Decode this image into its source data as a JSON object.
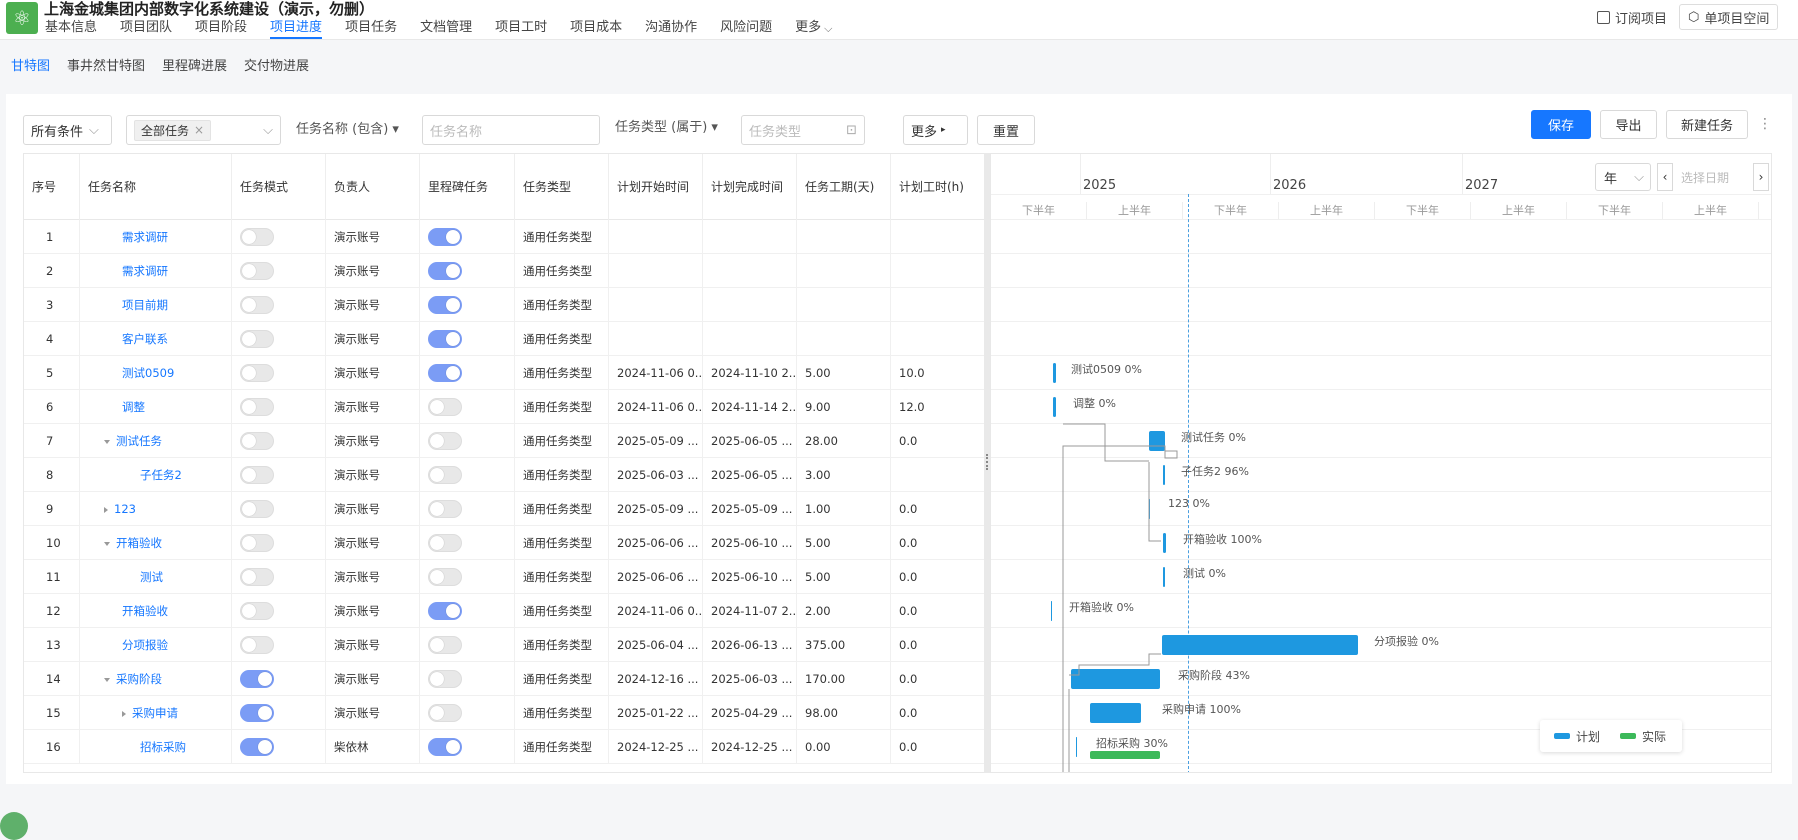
{
  "project": {
    "title": "上海金城集团内部数字化系统建设（演示，勿删）"
  },
  "nav": [
    "基本信息",
    "项目团队",
    "项目阶段",
    "项目进度",
    "项目任务",
    "文档管理",
    "项目工时",
    "项目成本",
    "沟通协作",
    "风险问题",
    "更多"
  ],
  "nav_active": 3,
  "topActions": {
    "subscribe": "订阅项目",
    "space": "单项目空间"
  },
  "subnav": [
    "甘特图",
    "事井然甘特图",
    "里程碑进展",
    "交付物进展"
  ],
  "filters": {
    "all_conditions": "所有条件",
    "all_tasks_tag": "全部任务",
    "name_label": "任务名称 (包含)",
    "name_placeholder": "任务名称",
    "type_label": "任务类型 (属于)",
    "type_placeholder": "任务类型",
    "more": "更多",
    "reset": "重置"
  },
  "actions": {
    "save": "保存",
    "export": "导出",
    "new_task": "新建任务"
  },
  "columns": [
    "序号",
    "任务名称",
    "任务模式",
    "负责人",
    "里程碑任务",
    "任务类型",
    "计划开始时间",
    "计划完成时间",
    "任务工期(天)",
    "计划工时(h)"
  ],
  "rows": [
    {
      "no": "1",
      "name": "需求调研",
      "indent": 0,
      "caret": "",
      "mode": false,
      "owner": "演示账号",
      "milestone": true,
      "type": "通用任务类型",
      "start": "",
      "end": "",
      "dur": "",
      "hours": ""
    },
    {
      "no": "2",
      "name": "需求调研",
      "indent": 0,
      "caret": "",
      "mode": false,
      "owner": "演示账号",
      "milestone": true,
      "type": "通用任务类型",
      "start": "",
      "end": "",
      "dur": "",
      "hours": ""
    },
    {
      "no": "3",
      "name": "项目前期",
      "indent": 0,
      "caret": "",
      "mode": false,
      "owner": "演示账号",
      "milestone": true,
      "type": "通用任务类型",
      "start": "",
      "end": "",
      "dur": "",
      "hours": ""
    },
    {
      "no": "4",
      "name": "客户联系",
      "indent": 0,
      "caret": "",
      "mode": false,
      "owner": "演示账号",
      "milestone": true,
      "type": "通用任务类型",
      "start": "",
      "end": "",
      "dur": "",
      "hours": ""
    },
    {
      "no": "5",
      "name": "测试0509",
      "indent": 0,
      "caret": "",
      "mode": false,
      "owner": "演示账号",
      "milestone": true,
      "type": "通用任务类型",
      "start": "2024-11-06 0...",
      "end": "2024-11-10 2...",
      "dur": "5.00",
      "hours": "10.0"
    },
    {
      "no": "6",
      "name": "调整",
      "indent": 0,
      "caret": "",
      "mode": false,
      "owner": "演示账号",
      "milestone": false,
      "type": "通用任务类型",
      "start": "2024-11-06 0...",
      "end": "2024-11-14 2...",
      "dur": "9.00",
      "hours": "12.0"
    },
    {
      "no": "7",
      "name": "测试任务",
      "indent": 0,
      "caret": "down",
      "mode": false,
      "owner": "演示账号",
      "milestone": false,
      "type": "通用任务类型",
      "start": "2025-05-09 ...",
      "end": "2025-06-05 ...",
      "dur": "28.00",
      "hours": "0.0"
    },
    {
      "no": "8",
      "name": "子任务2",
      "indent": 1,
      "caret": "",
      "mode": false,
      "owner": "演示账号",
      "milestone": false,
      "type": "通用任务类型",
      "start": "2025-06-03 ...",
      "end": "2025-06-05 ...",
      "dur": "3.00",
      "hours": ""
    },
    {
      "no": "9",
      "name": "123",
      "indent": 0,
      "caret": "right",
      "mode": false,
      "owner": "演示账号",
      "milestone": false,
      "type": "通用任务类型",
      "start": "2025-05-09 ...",
      "end": "2025-05-09 ...",
      "dur": "1.00",
      "hours": "0.0"
    },
    {
      "no": "10",
      "name": "开箱验收",
      "indent": 0,
      "caret": "down",
      "mode": false,
      "owner": "演示账号",
      "milestone": false,
      "type": "通用任务类型",
      "start": "2025-06-06 ...",
      "end": "2025-06-10 ...",
      "dur": "5.00",
      "hours": "0.0"
    },
    {
      "no": "11",
      "name": "测试",
      "indent": 1,
      "caret": "",
      "mode": false,
      "owner": "演示账号",
      "milestone": false,
      "type": "通用任务类型",
      "start": "2025-06-06 ...",
      "end": "2025-06-10 ...",
      "dur": "5.00",
      "hours": "0.0"
    },
    {
      "no": "12",
      "name": "开箱验收",
      "indent": 0,
      "caret": "",
      "mode": false,
      "owner": "演示账号",
      "milestone": true,
      "type": "通用任务类型",
      "start": "2024-11-06 0...",
      "end": "2024-11-07 2...",
      "dur": "2.00",
      "hours": "0.0"
    },
    {
      "no": "13",
      "name": "分项报验",
      "indent": 0,
      "caret": "",
      "mode": false,
      "owner": "演示账号",
      "milestone": false,
      "type": "通用任务类型",
      "start": "2025-06-04 ...",
      "end": "2026-06-13 ...",
      "dur": "375.00",
      "hours": "0.0"
    },
    {
      "no": "14",
      "name": "采购阶段",
      "indent": 0,
      "caret": "down",
      "mode": true,
      "owner": "演示账号",
      "milestone": false,
      "type": "通用任务类型",
      "start": "2024-12-16 ...",
      "end": "2025-06-03 ...",
      "dur": "170.00",
      "hours": "0.0"
    },
    {
      "no": "15",
      "name": "采购申请",
      "indent": 1,
      "caret": "right",
      "mode": true,
      "owner": "演示账号",
      "milestone": false,
      "type": "通用任务类型",
      "start": "2025-01-22 ...",
      "end": "2025-04-29 ...",
      "dur": "98.00",
      "hours": "0.0"
    },
    {
      "no": "16",
      "name": "招标采购",
      "indent": 1,
      "caret": "",
      "mode": true,
      "owner": "柴依林",
      "milestone": true,
      "type": "通用任务类型",
      "start": "2024-12-25 ...",
      "end": "2024-12-25 ...",
      "dur": "0.00",
      "hours": "0.0"
    }
  ],
  "gantt": {
    "years": [
      "2025",
      "2026",
      "2027"
    ],
    "halves": [
      "下半年",
      "上半年",
      "下半年",
      "上半年",
      "下半年",
      "上半年",
      "下半年",
      "上半年"
    ],
    "scale": "年",
    "date_placeholder": "选择日期",
    "bar_labels": [
      "测试0509 0%",
      "调整 0%",
      "测试任务 0%",
      "子任务2 96%",
      "123 0%",
      "开箱验收 100%",
      "测试 0%",
      "开箱验收 0%",
      "分项报验 0%",
      "采购阶段 43%",
      "采购申请 100%",
      "招标采购 30%"
    ],
    "legend": {
      "plan": "计划",
      "actual": "实际",
      "plan_color": "#1e98e0",
      "actual_color": "#3cb95a"
    }
  }
}
